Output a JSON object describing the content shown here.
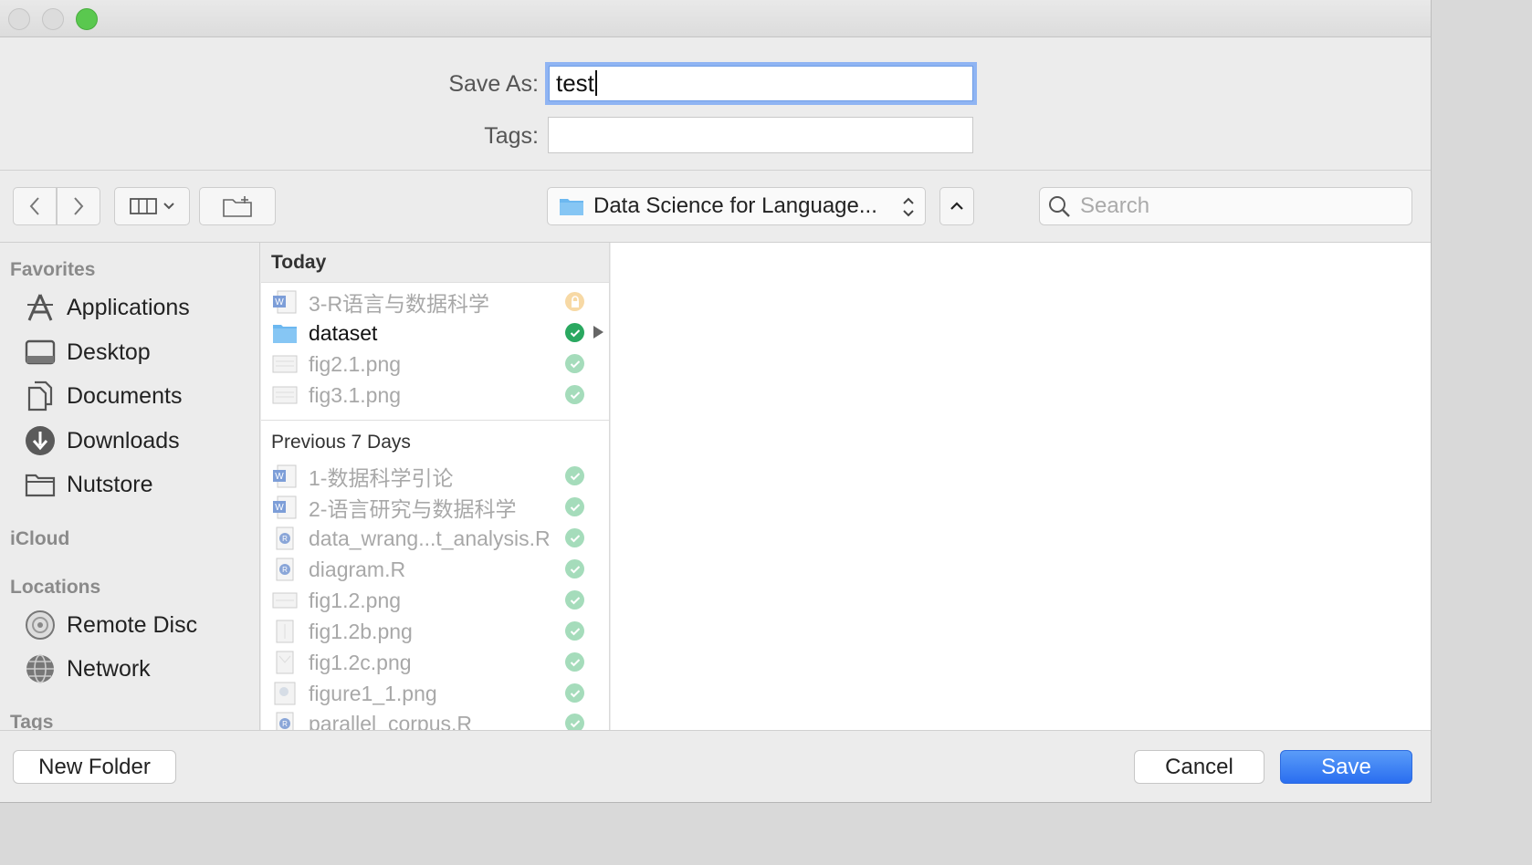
{
  "dialog": {
    "save_as_label": "Save As:",
    "save_as_value": "test",
    "tags_label": "Tags:",
    "tags_value": ""
  },
  "toolbar": {
    "location": "Data Science for Language...",
    "search_placeholder": "Search"
  },
  "sidebar": {
    "favorites_heading": "Favorites",
    "favorites": [
      {
        "label": "Applications",
        "icon": "applications-icon"
      },
      {
        "label": "Desktop",
        "icon": "desktop-icon"
      },
      {
        "label": "Documents",
        "icon": "documents-icon"
      },
      {
        "label": "Downloads",
        "icon": "downloads-icon"
      },
      {
        "label": "Nutstore",
        "icon": "folder-icon"
      }
    ],
    "icloud_heading": "iCloud",
    "locations_heading": "Locations",
    "locations": [
      {
        "label": "Remote Disc",
        "icon": "disc-icon"
      },
      {
        "label": "Network",
        "icon": "network-icon"
      }
    ],
    "tags_heading": "Tags"
  },
  "browser": {
    "today_heading": "Today",
    "today": [
      {
        "name": "3-R语言与数据科学",
        "icon": "word-doc-icon",
        "status": "lock"
      },
      {
        "name": "dataset",
        "icon": "folder-icon",
        "status": "synced",
        "active": true
      },
      {
        "name": "fig2.1.png",
        "icon": "image-icon",
        "status": "synced"
      },
      {
        "name": "fig3.1.png",
        "icon": "image-icon",
        "status": "synced"
      }
    ],
    "previous_heading": "Previous 7 Days",
    "previous": [
      {
        "name": "1-数据科学引论",
        "icon": "word-doc-icon",
        "status": "synced"
      },
      {
        "name": "2-语言研究与数据科学",
        "icon": "word-doc-icon",
        "status": "synced"
      },
      {
        "name": "data_wrang...t_analysis.R",
        "icon": "r-file-icon",
        "status": "synced"
      },
      {
        "name": "diagram.R",
        "icon": "r-file-icon",
        "status": "synced"
      },
      {
        "name": "fig1.2.png",
        "icon": "image-icon",
        "status": "synced"
      },
      {
        "name": "fig1.2b.png",
        "icon": "image-icon",
        "status": "synced"
      },
      {
        "name": "fig1.2c.png",
        "icon": "image-icon",
        "status": "synced"
      },
      {
        "name": "figure1_1.png",
        "icon": "image-icon",
        "status": "synced"
      },
      {
        "name": "parallel_corpus.R",
        "icon": "r-file-icon",
        "status": "synced"
      }
    ]
  },
  "buttons": {
    "new_folder": "New Folder",
    "cancel": "Cancel",
    "save": "Save"
  },
  "colors": {
    "accent": "#2a6ef0",
    "focus_ring": "#8fb4f3",
    "synced": "#2aa860",
    "folder": "#6cb8f0"
  }
}
